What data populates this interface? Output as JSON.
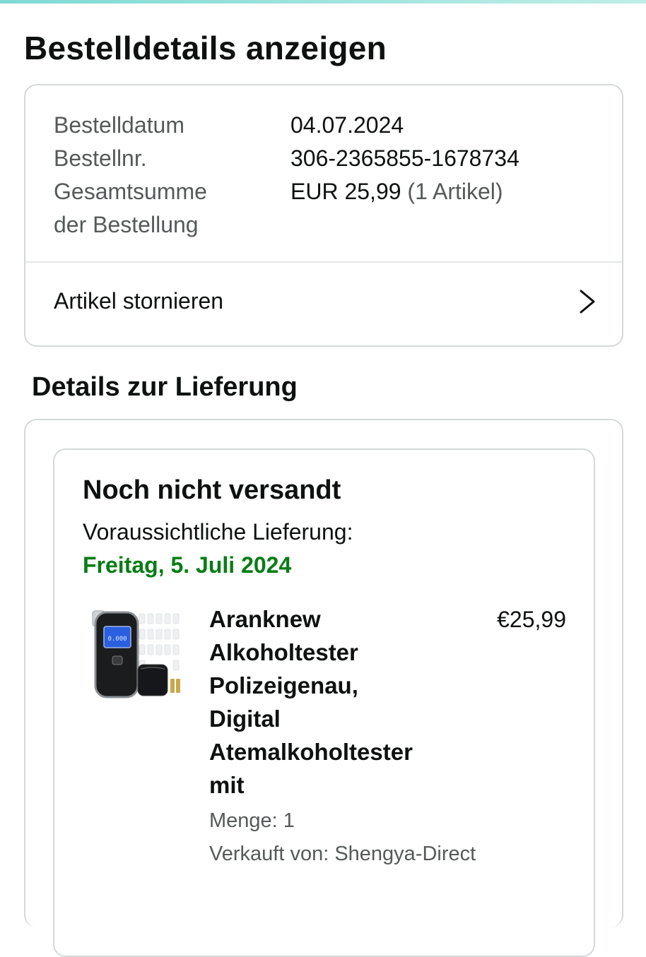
{
  "page": {
    "title": "Bestelldetails anzeigen"
  },
  "order": {
    "date_label": "Bestelldatum",
    "date_value": "04.07.2024",
    "number_label": "Bestellnr.",
    "number_value": "306-2365855-1678734",
    "total_label_line1": "Gesamtsumme",
    "total_label_line2": "der Bestellung",
    "total_value": "EUR 25,99",
    "total_items": "(1 Artikel)",
    "cancel_label": "Artikel stornieren"
  },
  "delivery": {
    "section_title": "Details zur Lieferung",
    "status": "Noch nicht versandt",
    "eta_label": "Voraussichtliche Lieferung:",
    "eta_date": "Freitag, 5. Juli 2024",
    "eta_color": "#067d14"
  },
  "product": {
    "title": "Aranknew Alkoholtester Polizeigenau, Digital Atemalkoholtester mit",
    "price": "€25,99",
    "quantity": "Menge: 1",
    "seller": "Verkauft von: Shengya-Direct",
    "screen_text": "0.000"
  },
  "icons": {
    "chevron": "chevron-right-icon"
  },
  "colors": {
    "accent_bar": "#7fd9d4",
    "border": "#d5d9d9",
    "muted_text": "#565959",
    "text": "#0f1111"
  }
}
